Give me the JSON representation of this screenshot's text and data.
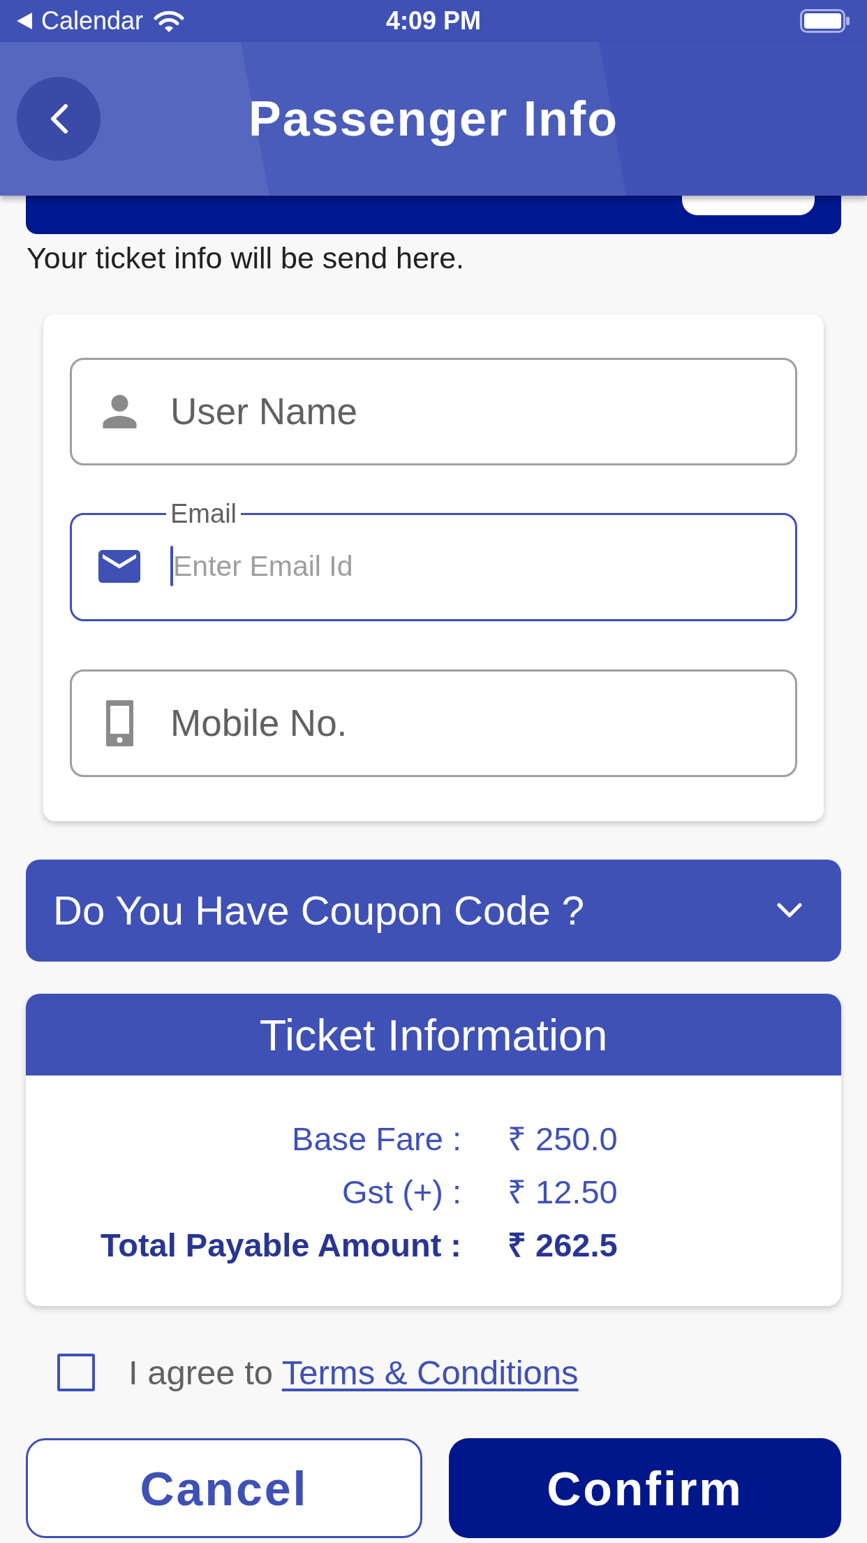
{
  "status_bar": {
    "back_label": "Calendar",
    "time": "4:09 PM"
  },
  "header": {
    "title": "Passenger Info"
  },
  "notice": "Your ticket info will be send here.",
  "fields": [
    {
      "kind": "name",
      "label": "User Name",
      "focused": false
    },
    {
      "kind": "email",
      "label": "Email",
      "placeholder": "Enter Email Id",
      "focused": true
    },
    {
      "kind": "mobile",
      "label": "Mobile No.",
      "focused": false
    }
  ],
  "coupon": {
    "label": "Do You Have Coupon Code ?",
    "expanded": false
  },
  "ticket_info": {
    "title": "Ticket Information",
    "rows": [
      {
        "label": "Base Fare :",
        "value": "₹ 250.0",
        "total": false
      },
      {
        "label": "Gst (+) :",
        "value": "₹ 12.50",
        "total": false
      },
      {
        "label": "Total Payable Amount :",
        "value": "₹ 262.5",
        "total": true
      }
    ]
  },
  "agreement": {
    "checked": false,
    "text": "I agree to",
    "link": "Terms & Conditions"
  },
  "buttons": [
    {
      "kind": "cancel",
      "label": "Cancel"
    },
    {
      "kind": "confirm",
      "label": "Confirm"
    }
  ]
}
